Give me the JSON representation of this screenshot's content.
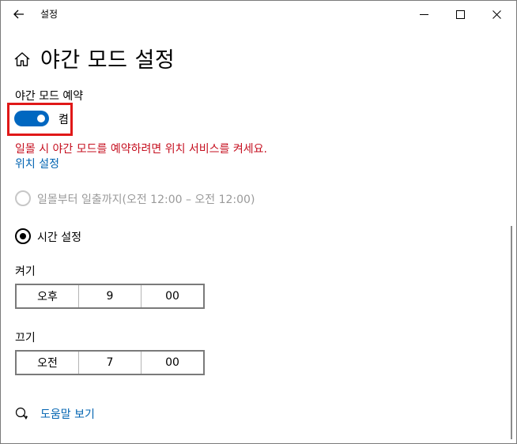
{
  "window": {
    "title": "설정",
    "back_icon": "arrow-left-icon",
    "minimize_icon": "minimize-icon",
    "maximize_icon": "maximize-icon",
    "close_icon": "close-icon"
  },
  "header": {
    "icon": "home-icon",
    "title": "야간 모드 설정"
  },
  "schedule": {
    "label": "야간 모드 예약",
    "toggle_state": "켬",
    "toggle_on": true,
    "accent_color": "#0067c0",
    "highlight_color": "#e01818"
  },
  "warning": {
    "text": "일몰 시 야간 모드를 예약하려면 위치 서비스를 켜세요.",
    "color": "#c50f1f"
  },
  "location_link": "위치 설정",
  "options": [
    {
      "label": "일몰부터 일출까지(오전 12:00 – 오전 12:00)",
      "selected": false,
      "disabled": true
    },
    {
      "label": "시간 설정",
      "selected": true,
      "disabled": false
    }
  ],
  "turn_on": {
    "label": "켜기",
    "ampm": "오후",
    "hour": "9",
    "minute": "00"
  },
  "turn_off": {
    "label": "끄기",
    "ampm": "오전",
    "hour": "7",
    "minute": "00"
  },
  "help": {
    "icon": "help-chat-icon",
    "label": "도움말 보기"
  }
}
